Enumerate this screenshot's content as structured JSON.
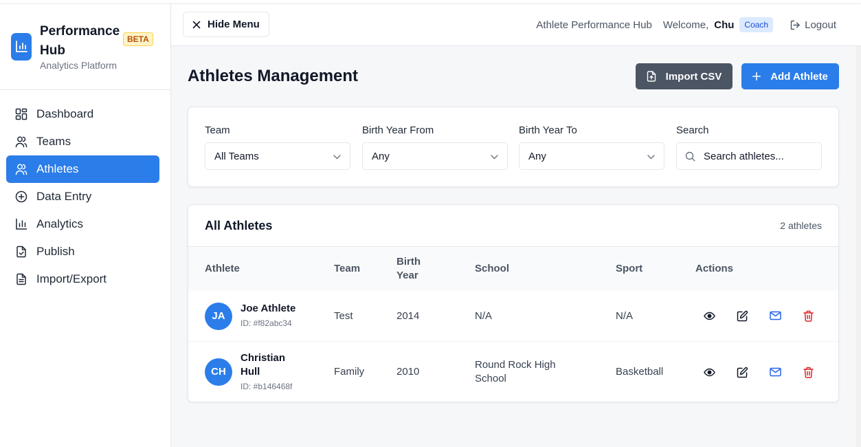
{
  "brand": {
    "name": "Performance Hub",
    "badge": "BETA",
    "subtitle": "Analytics Platform"
  },
  "sidebar": {
    "items": [
      {
        "label": "Dashboard",
        "icon": "dashboard-icon"
      },
      {
        "label": "Teams",
        "icon": "users-icon"
      },
      {
        "label": "Athletes",
        "icon": "user-icon",
        "active": true
      },
      {
        "label": "Data Entry",
        "icon": "plus-circle-icon"
      },
      {
        "label": "Analytics",
        "icon": "bar-chart-icon"
      },
      {
        "label": "Publish",
        "icon": "file-check-icon"
      },
      {
        "label": "Import/Export",
        "icon": "file-text-icon"
      }
    ]
  },
  "header": {
    "hide_menu": "Hide Menu",
    "app_name": "Athlete Performance Hub",
    "welcome": "Welcome,",
    "user": "Chu",
    "role": "Coach",
    "logout": "Logout"
  },
  "page": {
    "title": "Athletes Management",
    "import_label": "Import CSV",
    "add_label": "Add Athlete"
  },
  "filters": {
    "team": {
      "label": "Team",
      "value": "All Teams"
    },
    "birth_from": {
      "label": "Birth Year From",
      "value": "Any"
    },
    "birth_to": {
      "label": "Birth Year To",
      "value": "Any"
    },
    "search": {
      "label": "Search",
      "placeholder": "Search athletes..."
    }
  },
  "table": {
    "title": "All Athletes",
    "count": "2 athletes",
    "columns": {
      "athlete": "Athlete",
      "team": "Team",
      "birth_year_1": "Birth",
      "birth_year_2": "Year",
      "school": "School",
      "sport": "Sport",
      "actions": "Actions"
    },
    "rows": [
      {
        "initials": "JA",
        "name_line1": "Joe Athlete",
        "name_line2": "",
        "id": "ID: #f82abc34",
        "team": "Test",
        "birth_year": "2014",
        "school_line1": "N/A",
        "school_line2": "",
        "sport": "N/A"
      },
      {
        "initials": "CH",
        "name_line1": "Christian",
        "name_line2": "Hull",
        "id": "ID: #b146468f",
        "team": "Family",
        "birth_year": "2010",
        "school_line1": "Round Rock High",
        "school_line2": "School",
        "sport": "Basketball"
      }
    ]
  },
  "colors": {
    "accent": "#2b7de9",
    "import_button": "#4b5563",
    "delete": "#dc2626",
    "email": "#2563eb"
  }
}
